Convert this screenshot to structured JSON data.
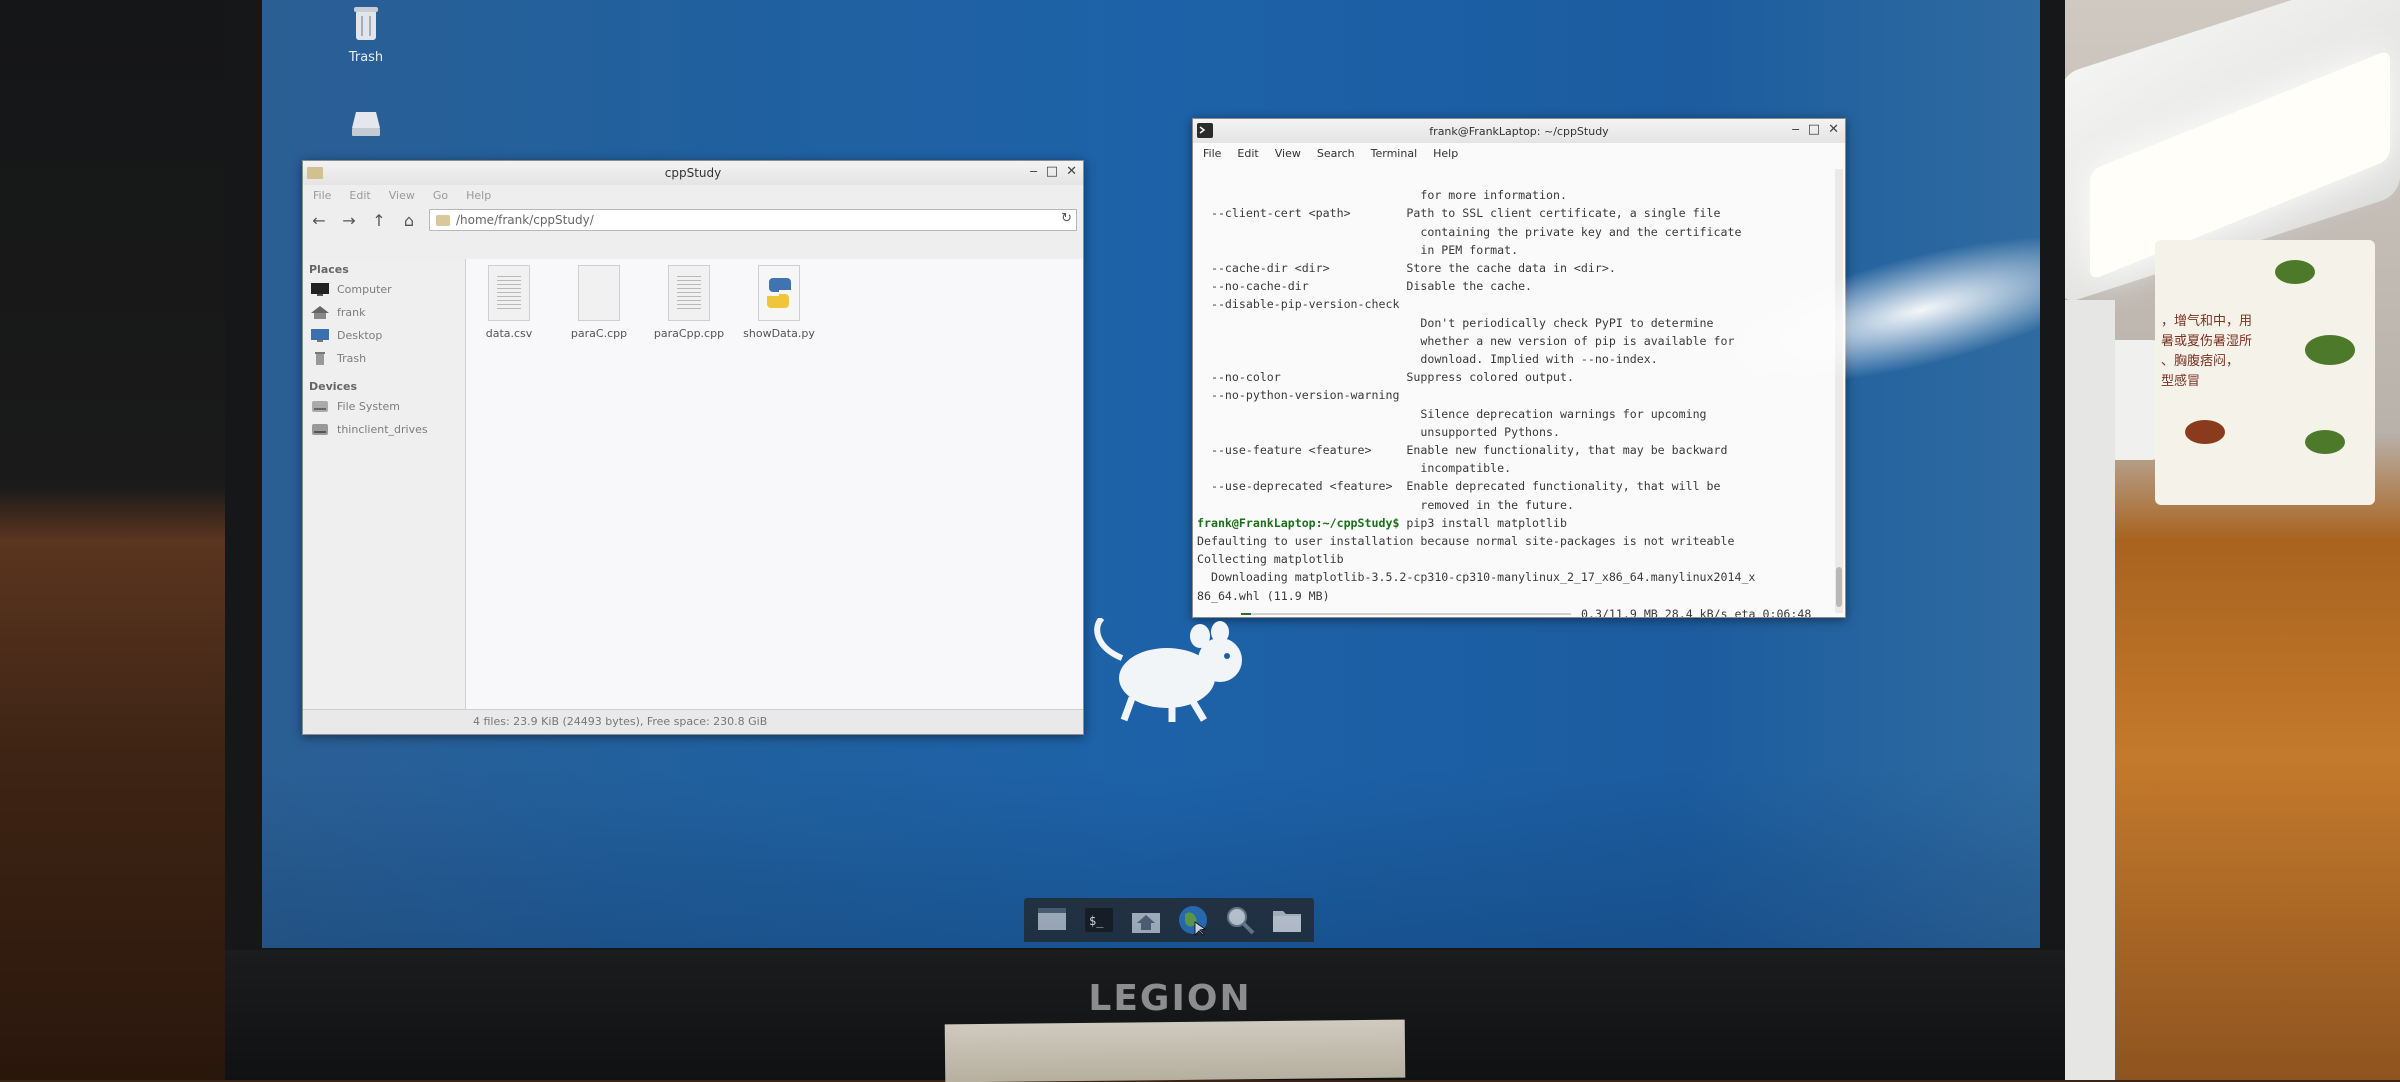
{
  "desktop": {
    "icons": [
      {
        "label": "Trash",
        "icon": "trash-icon"
      },
      {
        "label": "",
        "icon": "drive-icon"
      }
    ]
  },
  "file_manager": {
    "title": "cppStudy",
    "menu": [
      "File",
      "Edit",
      "View",
      "Go",
      "Help"
    ],
    "path": "/home/frank/cppStudy/",
    "sidebar": {
      "places_header": "Places",
      "places": [
        {
          "label": "Computer",
          "icon": "computer-icon"
        },
        {
          "label": "frank",
          "icon": "home-icon"
        },
        {
          "label": "Desktop",
          "icon": "desktop-icon"
        },
        {
          "label": "Trash",
          "icon": "trash-icon"
        }
      ],
      "devices_header": "Devices",
      "devices": [
        {
          "label": "File System",
          "icon": "drive-icon"
        },
        {
          "label": "thinclient_drives",
          "icon": "drive-icon"
        }
      ]
    },
    "files": [
      {
        "name": "data.csv",
        "icon": "text-file-icon"
      },
      {
        "name": "paraC.cpp",
        "icon": "blank-file-icon"
      },
      {
        "name": "paraCpp.cpp",
        "icon": "text-file-icon"
      },
      {
        "name": "showData.py",
        "icon": "python-file-icon"
      }
    ],
    "status": "4 files: 23.9 KiB (24493 bytes), Free space: 230.8 GiB"
  },
  "terminal": {
    "title": "frank@FrankLaptop: ~/cppStudy",
    "menu": [
      "File",
      "Edit",
      "View",
      "Search",
      "Terminal",
      "Help"
    ],
    "lines": [
      "                                for more information.",
      "  --client-cert <path>        Path to SSL client certificate, a single file",
      "                                containing the private key and the certificate",
      "                                in PEM format.",
      "  --cache-dir <dir>           Store the cache data in <dir>.",
      "  --no-cache-dir              Disable the cache.",
      "  --disable-pip-version-check",
      "                                Don't periodically check PyPI to determine",
      "                                whether a new version of pip is available for",
      "                                download. Implied with --no-index.",
      "  --no-color                  Suppress colored output.",
      "  --no-python-version-warning",
      "                                Silence deprecation warnings for upcoming",
      "                                unsupported Pythons.",
      "  --use-feature <feature>     Enable new functionality, that may be backward",
      "                                incompatible.",
      "  --use-deprecated <feature>  Enable deprecated functionality, that will be",
      "                                removed in the future."
    ],
    "prompt": "frank@FrankLaptop:~/cppStudy$",
    "command": " pip3 install matplotlib",
    "output": [
      "Defaulting to user installation because normal site-packages is not writeable",
      "Collecting matplotlib",
      "  Downloading matplotlib-3.5.2-cp310-cp310-manylinux_2_17_x86_64.manylinux2014_x",
      "86_64.whl (11.9 MB)"
    ],
    "progress": {
      "text": "0.3/11.9 MB 28.4 kB/s eta 0:06:48",
      "fraction": 0.03
    }
  },
  "dock": {
    "items": [
      "show-desktop-icon",
      "terminal-icon",
      "home-folder-icon",
      "web-browser-icon",
      "app-finder-icon",
      "folder-icon"
    ]
  },
  "monitor": {
    "brand": "LEGION"
  },
  "colors": {
    "desktop_blue": "#1d62a8",
    "prompt_green": "#1b6f1b",
    "dock": "#27333f"
  }
}
